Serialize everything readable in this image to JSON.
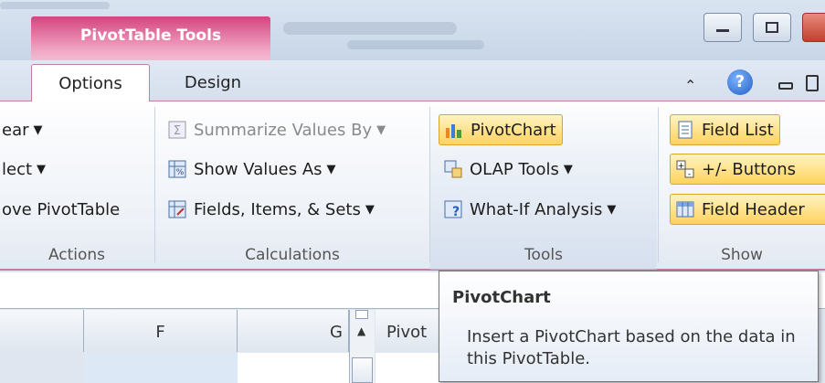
{
  "context_tab": "PivotTable Tools",
  "tabs": [
    {
      "label": "Options"
    },
    {
      "label": "Design"
    }
  ],
  "groups": {
    "actions": {
      "label": "Actions",
      "items": [
        "ear",
        "lect",
        "ove PivotTable"
      ]
    },
    "calculations": {
      "label": "Calculations",
      "items": [
        "Summarize Values By",
        "Show Values As",
        "Fields, Items, & Sets"
      ]
    },
    "tools": {
      "label": "Tools",
      "items": [
        "PivotChart",
        "OLAP Tools",
        "What-If Analysis"
      ]
    },
    "show": {
      "label": "Show",
      "items": [
        "Field List",
        "+/- Buttons",
        "Field Header"
      ]
    }
  },
  "columns": {
    "f": "F",
    "g": "G",
    "pivot": "Pivot"
  },
  "tooltip": {
    "title": "PivotChart",
    "description": "Insert a PivotChart based on the data in this PivotTable."
  },
  "colors": {
    "accent": "#c77ca2",
    "context": "#d4457f",
    "highlight": "#ffd35d"
  }
}
